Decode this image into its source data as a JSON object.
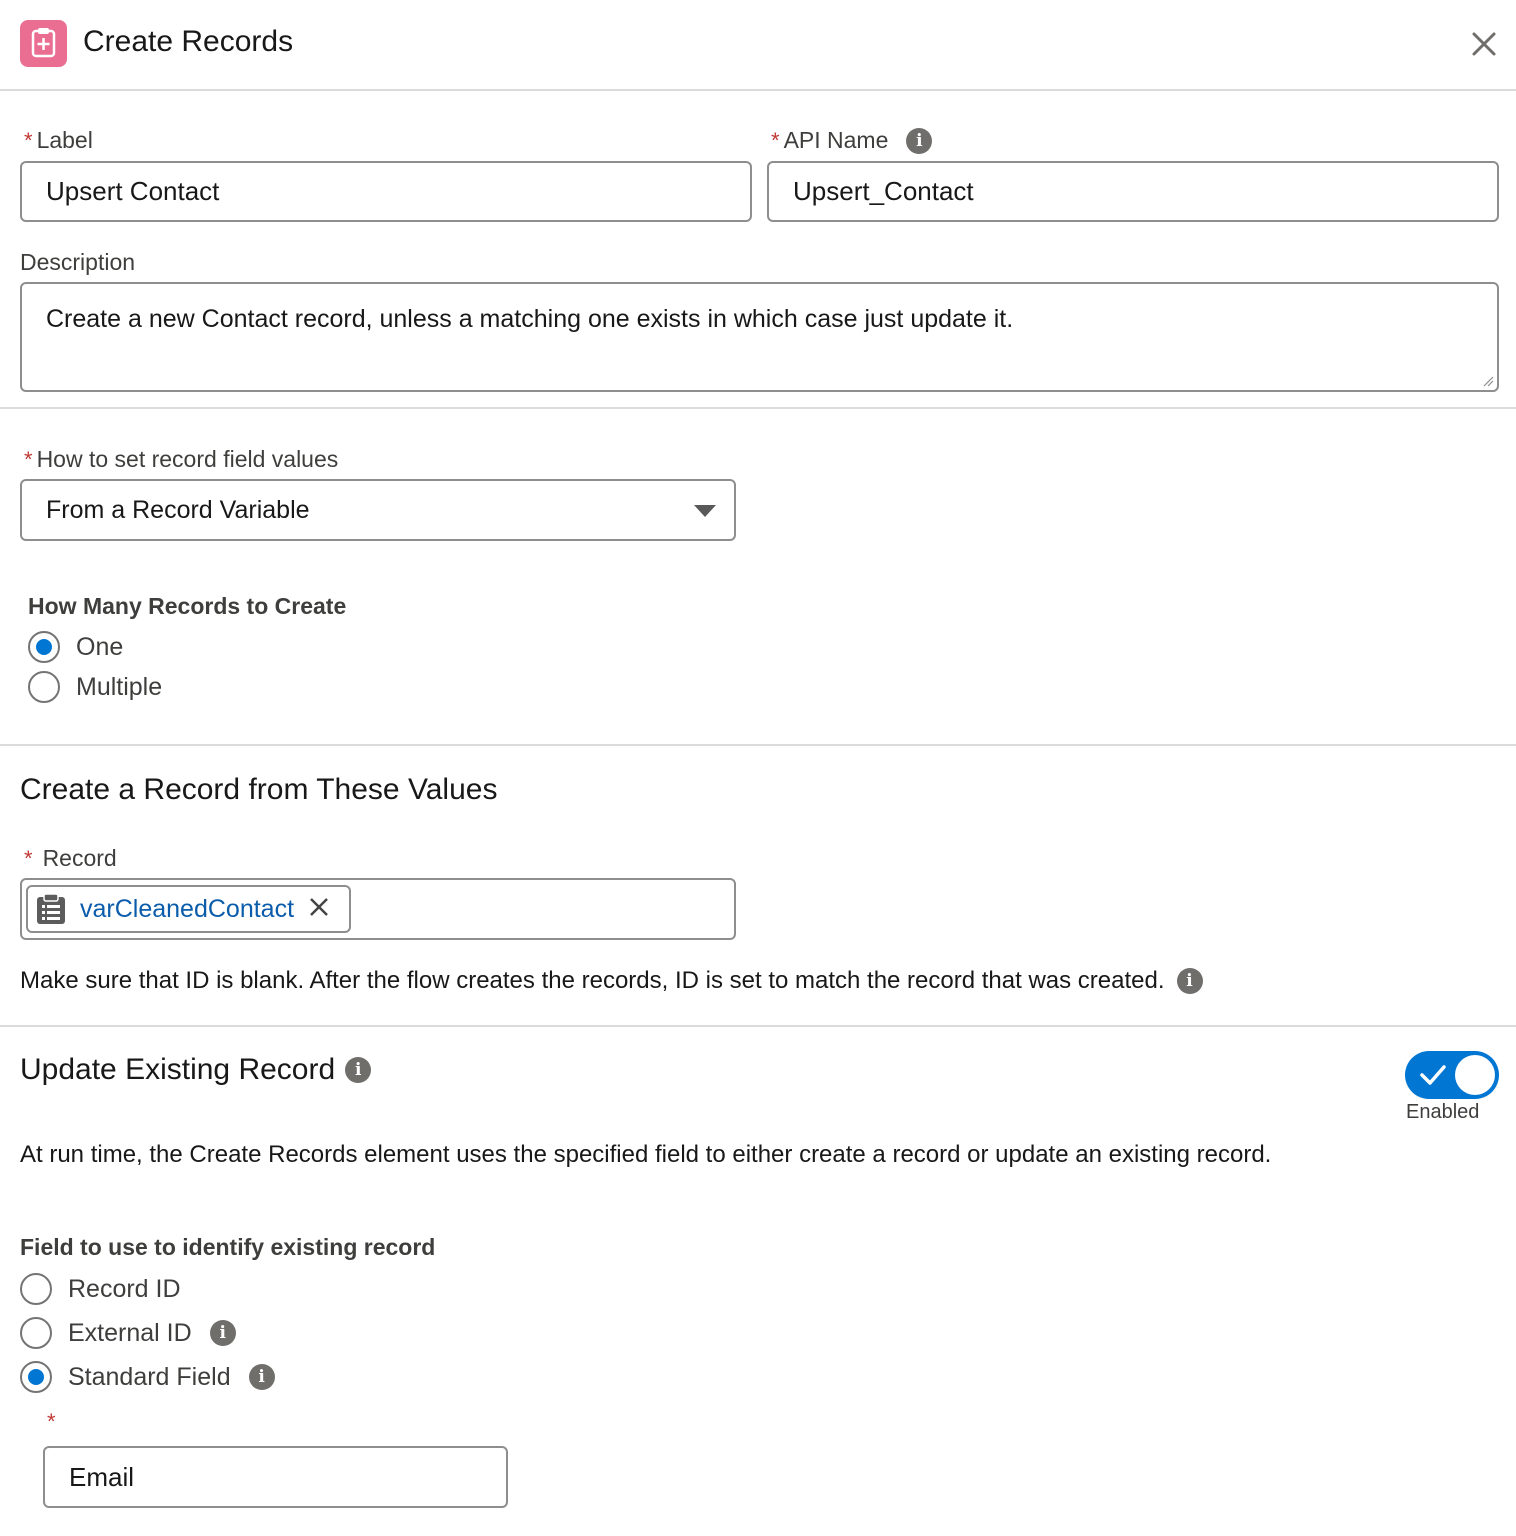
{
  "header": {
    "title": "Create Records",
    "icon": "clipboard-plus-icon",
    "icon_color": "#ea6e92"
  },
  "fields": {
    "label": {
      "label": "Label",
      "value": "Upsert Contact",
      "required": "*"
    },
    "api_name": {
      "label": "API Name",
      "value": "Upsert_Contact",
      "required": "*"
    },
    "description": {
      "label": "Description",
      "value": "Create a new Contact record, unless a matching one exists in which case just update it."
    }
  },
  "record_values": {
    "label": "How to set record field values",
    "required": "*",
    "selected": "From a Record Variable"
  },
  "how_many": {
    "title": "How Many Records to Create",
    "options": [
      {
        "label": "One",
        "checked": true
      },
      {
        "label": "Multiple",
        "checked": false
      }
    ]
  },
  "create_section": {
    "title": "Create a Record from These Values",
    "record_label": "Record",
    "required": "*",
    "record_value": "varCleanedContact",
    "help": "Make sure that ID is blank. After the flow creates the records, ID is set to match the record that was created."
  },
  "update_section": {
    "title": "Update Existing Record",
    "toggle_state": "Enabled",
    "toggle_on": true,
    "description": "At run time, the Create Records element uses the specified field to either create a record or update an existing record.",
    "field_group_title": "Field to use to identify existing record",
    "options": [
      {
        "label": "Record ID",
        "checked": false
      },
      {
        "label": "External ID",
        "checked": false
      },
      {
        "label": "Standard Field",
        "checked": true
      }
    ],
    "standard_field_required": "*",
    "standard_field_value": "Email"
  },
  "colors": {
    "accent": "#0176d3",
    "link": "#0b5cab",
    "required": "#c23934"
  }
}
